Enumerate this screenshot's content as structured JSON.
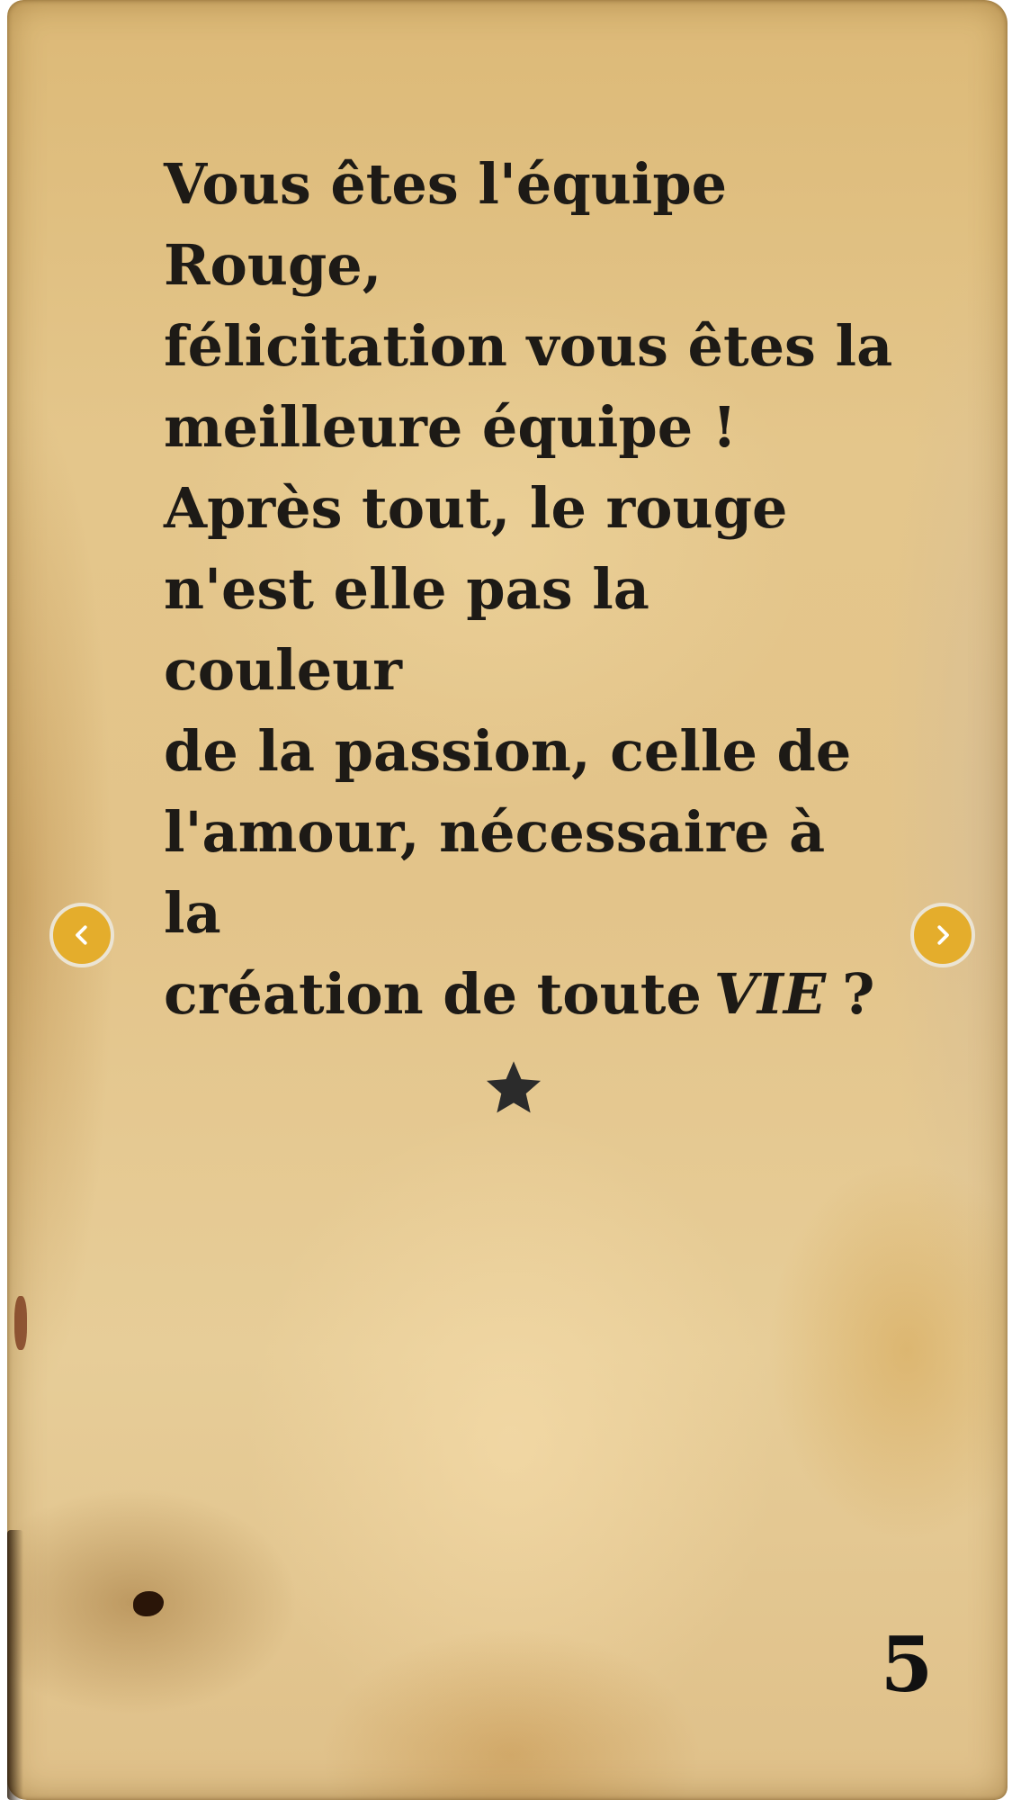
{
  "story": {
    "paragraph1": {
      "line1": "Vous êtes l'équipe Rouge,",
      "line2": "félicitation vous êtes la",
      "line3": "meilleure équipe !"
    },
    "paragraph2": {
      "line1": "Après tout, le rouge",
      "line2": "n'est elle pas la couleur",
      "line3": "de la passion, celle de",
      "line4": "l'amour, nécessaire à la",
      "line5_prefix": "création de toute",
      "line5_emphasis": "VIE",
      "line5_suffix": "?"
    }
  },
  "navigation": {
    "prev_icon": "chevron-left-icon",
    "next_icon": "chevron-right-icon",
    "button_color": "#e4ad2c"
  },
  "decoration": {
    "star_icon": "star-icon"
  },
  "page_number": "5",
  "colors": {
    "text": "#1d1a16",
    "parchment": "#e3c48a"
  }
}
